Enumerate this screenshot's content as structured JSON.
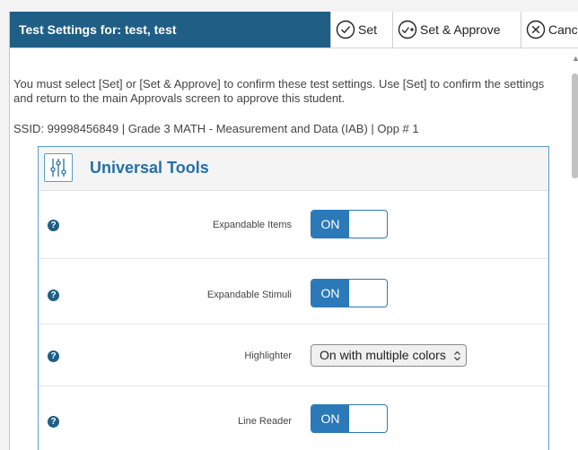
{
  "header": {
    "title": "Test Settings for: test, test",
    "set_label": "Set",
    "set_approve_label": "Set & Approve",
    "cancel_label": "Cancel"
  },
  "instructions": "You must select [Set] or [Set & Approve] to confirm these test settings. Use [Set] to confirm the settings and return to the main Approvals screen to approve this student.",
  "ssid_line": "SSID: 99998456849 | Grade 3 MATH - Measurement and Data (IAB) | Opp # 1",
  "panel": {
    "title": "Universal Tools",
    "help_glyph": "?",
    "rows": [
      {
        "label": "Expandable Items",
        "control": "toggle",
        "value": "ON"
      },
      {
        "label": "Expandable Stimuli",
        "control": "toggle",
        "value": "ON"
      },
      {
        "label": "Highlighter",
        "control": "select",
        "value": "On with multiple colors"
      },
      {
        "label": "Line Reader",
        "control": "toggle",
        "value": "ON"
      }
    ]
  },
  "colors": {
    "title_bar": "#1f5f86",
    "accent": "#2b79b8",
    "panel_title": "#2670a8",
    "panel_border": "#5d9cc9"
  }
}
